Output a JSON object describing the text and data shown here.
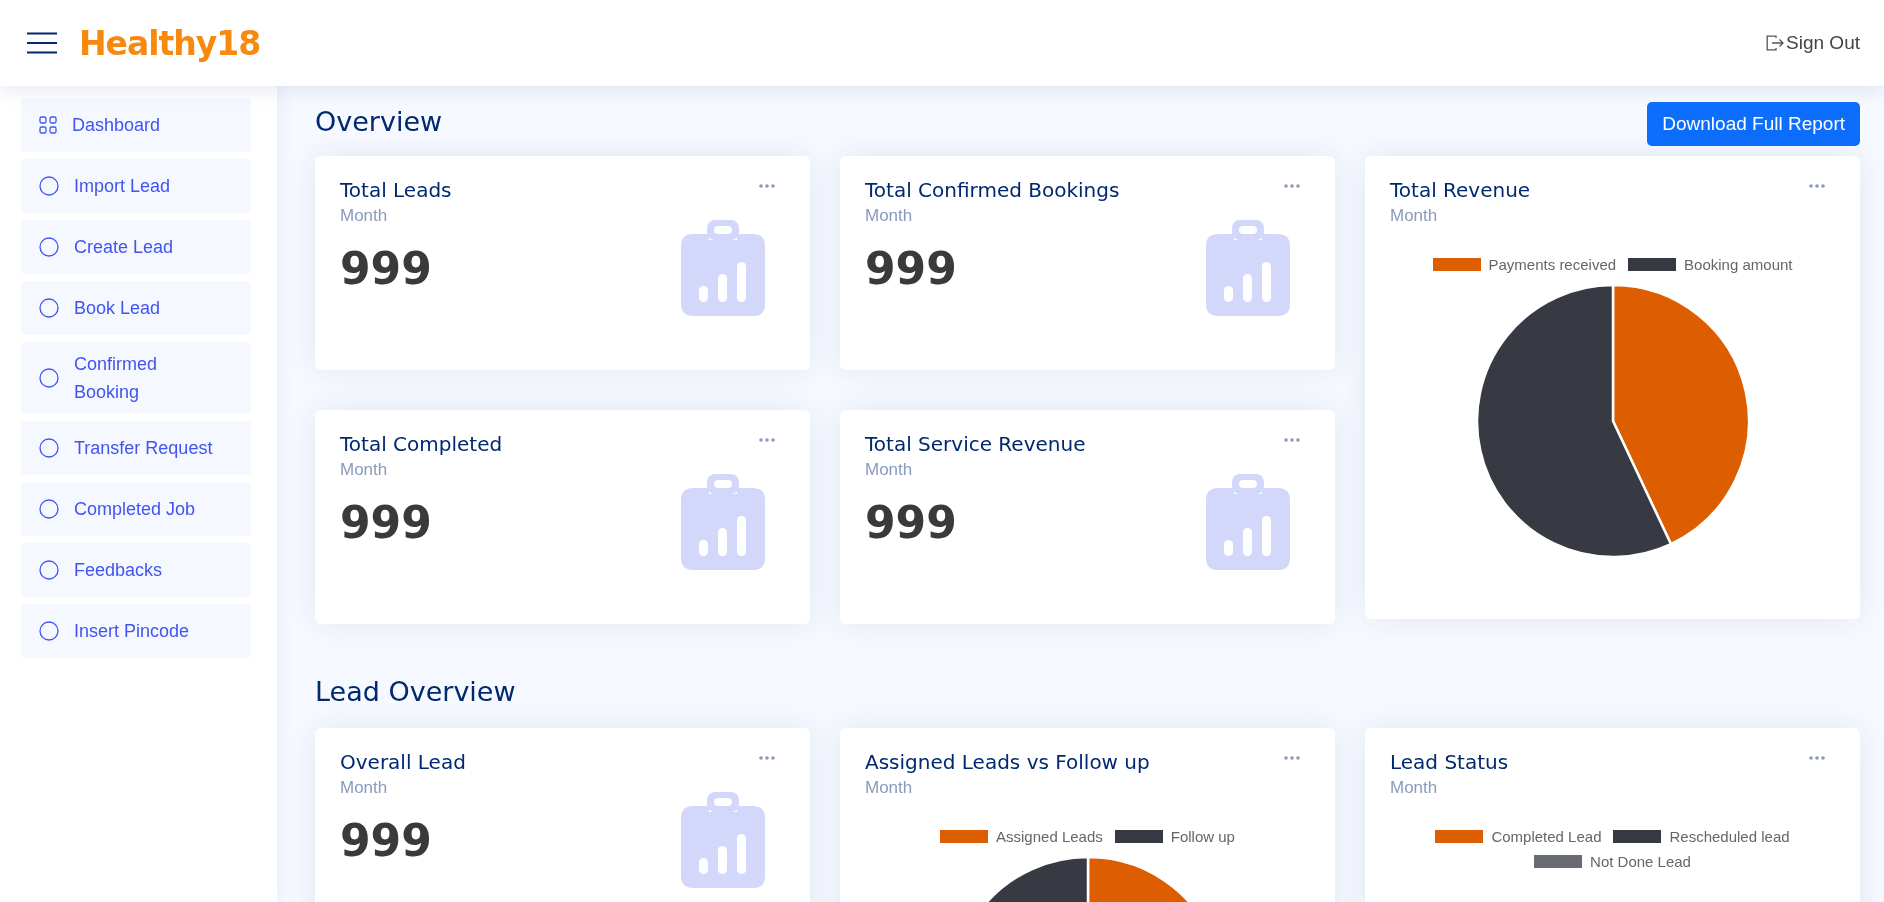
{
  "header": {
    "logo": "Healthy18",
    "sign_out": "Sign Out"
  },
  "sidebar": {
    "items": [
      {
        "label": "Dashboard",
        "kind": "grid"
      },
      {
        "label": "Import Lead",
        "kind": "circle"
      },
      {
        "label": "Create Lead",
        "kind": "circle"
      },
      {
        "label": "Book Lead",
        "kind": "circle"
      },
      {
        "label": "Confirmed Booking",
        "kind": "circle"
      },
      {
        "label": "Transfer Request",
        "kind": "circle"
      },
      {
        "label": "Completed Job",
        "kind": "circle"
      },
      {
        "label": "Feedbacks",
        "kind": "circle"
      },
      {
        "label": "Insert Pincode",
        "kind": "circle"
      }
    ]
  },
  "sections": [
    {
      "title": "Overview",
      "button": "Download Full Report",
      "cards": [
        {
          "kind": "stat",
          "title": "Total Leads",
          "period": "Month",
          "value": "999"
        },
        {
          "kind": "stat",
          "title": "Total Confirmed Bookings",
          "period": "Month",
          "value": "999"
        },
        {
          "kind": "pie",
          "title": "Total Revenue",
          "period": "Month",
          "chart_visible": true,
          "legend": [
            {
              "label": "Payments received",
              "color": "#dc5e00"
            },
            {
              "label": "Booking amount",
              "color": "#373a42"
            }
          ]
        },
        {
          "kind": "stat",
          "title": "Total Completed",
          "period": "Month",
          "value": "999"
        },
        {
          "kind": "stat",
          "title": "Total Service Revenue",
          "period": "Month",
          "value": "999"
        }
      ]
    },
    {
      "title": "Lead Overview",
      "cards": [
        {
          "kind": "stat",
          "title": "Overall Lead",
          "period": "Month",
          "value": "999"
        },
        {
          "kind": "pie",
          "title": "Assigned Leads vs Follow up",
          "period": "Month",
          "chart_visible": true,
          "legend": [
            {
              "label": "Assigned Leads",
              "color": "#dc5e00"
            },
            {
              "label": "Follow up",
              "color": "#373a42"
            }
          ]
        },
        {
          "kind": "pie",
          "title": "Lead Status",
          "period": "Month",
          "chart_visible": false,
          "legend": [
            {
              "label": "Completed Lead",
              "color": "#dc5e00"
            },
            {
              "label": "Rescheduled lead",
              "color": "#373a42"
            },
            {
              "label": "Not Done Lead",
              "color": "#686b73"
            }
          ]
        }
      ]
    }
  ]
}
